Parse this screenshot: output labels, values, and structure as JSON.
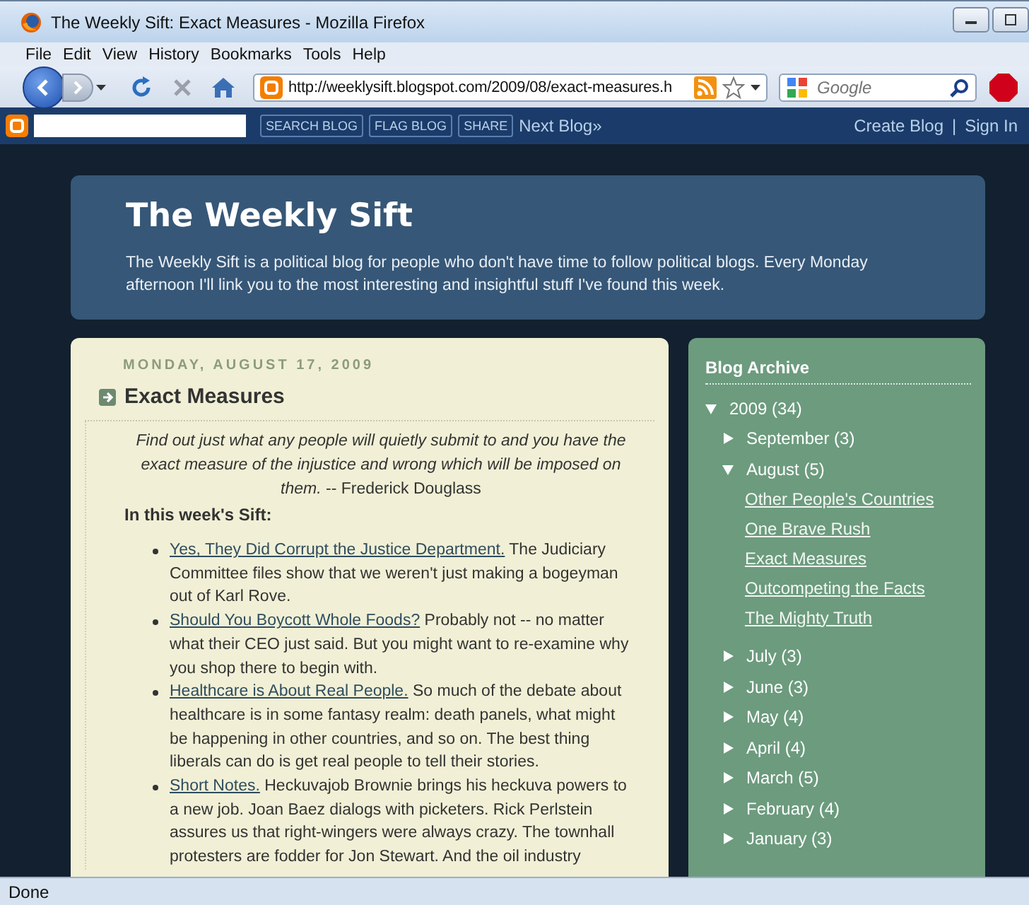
{
  "window": {
    "title": "The Weekly Sift: Exact Measures - Mozilla Firefox"
  },
  "menu": [
    "File",
    "Edit",
    "View",
    "History",
    "Bookmarks",
    "Tools",
    "Help"
  ],
  "toolbar": {
    "url": "http://weeklysift.blogspot.com/2009/08/exact-measures.h",
    "search_placeholder": "Google"
  },
  "blog_navbar": {
    "buttons": [
      "SEARCH BLOG",
      "FLAG BLOG",
      "SHARE"
    ],
    "next": "Next Blog»",
    "create": "Create Blog",
    "separator": "|",
    "sign_in": "Sign In"
  },
  "header": {
    "title": "The Weekly Sift",
    "description": "The Weekly Sift is a political blog for people who don't have time to follow political blogs. Every Monday afternoon I'll link you to the most interesting and insightful stuff I've found this week."
  },
  "post": {
    "date": "MONDAY, AUGUST 17, 2009",
    "title": "Exact Measures",
    "quote": "*Find out just what any people will quietly submit to and you have the exact measure of the injustice and wrong which will be imposed on them.* -- Frederick Douglass",
    "intro": "In this week's Sift:",
    "items": [
      {
        "link": "Yes, They Did Corrupt the Justice Department.",
        "text": "The Judiciary Committee files show that we weren't just making a bogeyman out of Karl Rove."
      },
      {
        "link": "Should You Boycott Whole Foods?",
        "text": "Probably not -- no matter what their CEO just said. But you might want to re-examine why you shop there to begin with."
      },
      {
        "link": "Healthcare is About Real People.",
        "text": "So much of the debate about healthcare is in some fantasy realm: death panels, what might be happening in other countries, and so on. The best thing liberals can do is get real people to tell their stories."
      },
      {
        "link": "Short Notes.",
        "text": "Heckuvajob Brownie brings his heckuva powers to a new job. Joan Baez dialogs with picketers. Rick Perlstein assures us that right-wingers were always crazy. The townhall protesters are fodder for Jon Stewart. And the oil industry"
      }
    ]
  },
  "archive": {
    "title": "Blog Archive",
    "years": [
      {
        "label": "2009 (34)",
        "expanded": true,
        "children": [
          {
            "label": "September (3)",
            "expanded": false
          },
          {
            "label": "August (5)",
            "expanded": true,
            "children": [
              {
                "label": "Other People's Countries"
              },
              {
                "label": "One Brave Rush"
              },
              {
                "label": "Exact Measures"
              },
              {
                "label": "Outcompeting the Facts"
              },
              {
                "label": "The Mighty Truth"
              }
            ]
          },
          {
            "label": "July (3)",
            "expanded": false
          },
          {
            "label": "June (3)",
            "expanded": false
          },
          {
            "label": "May (4)",
            "expanded": false
          },
          {
            "label": "April (4)",
            "expanded": false
          },
          {
            "label": "March (5)",
            "expanded": false
          },
          {
            "label": "February (4)",
            "expanded": false
          },
          {
            "label": "January (3)",
            "expanded": false
          }
        ]
      }
    ]
  },
  "status_bar": {
    "text": "Done"
  }
}
